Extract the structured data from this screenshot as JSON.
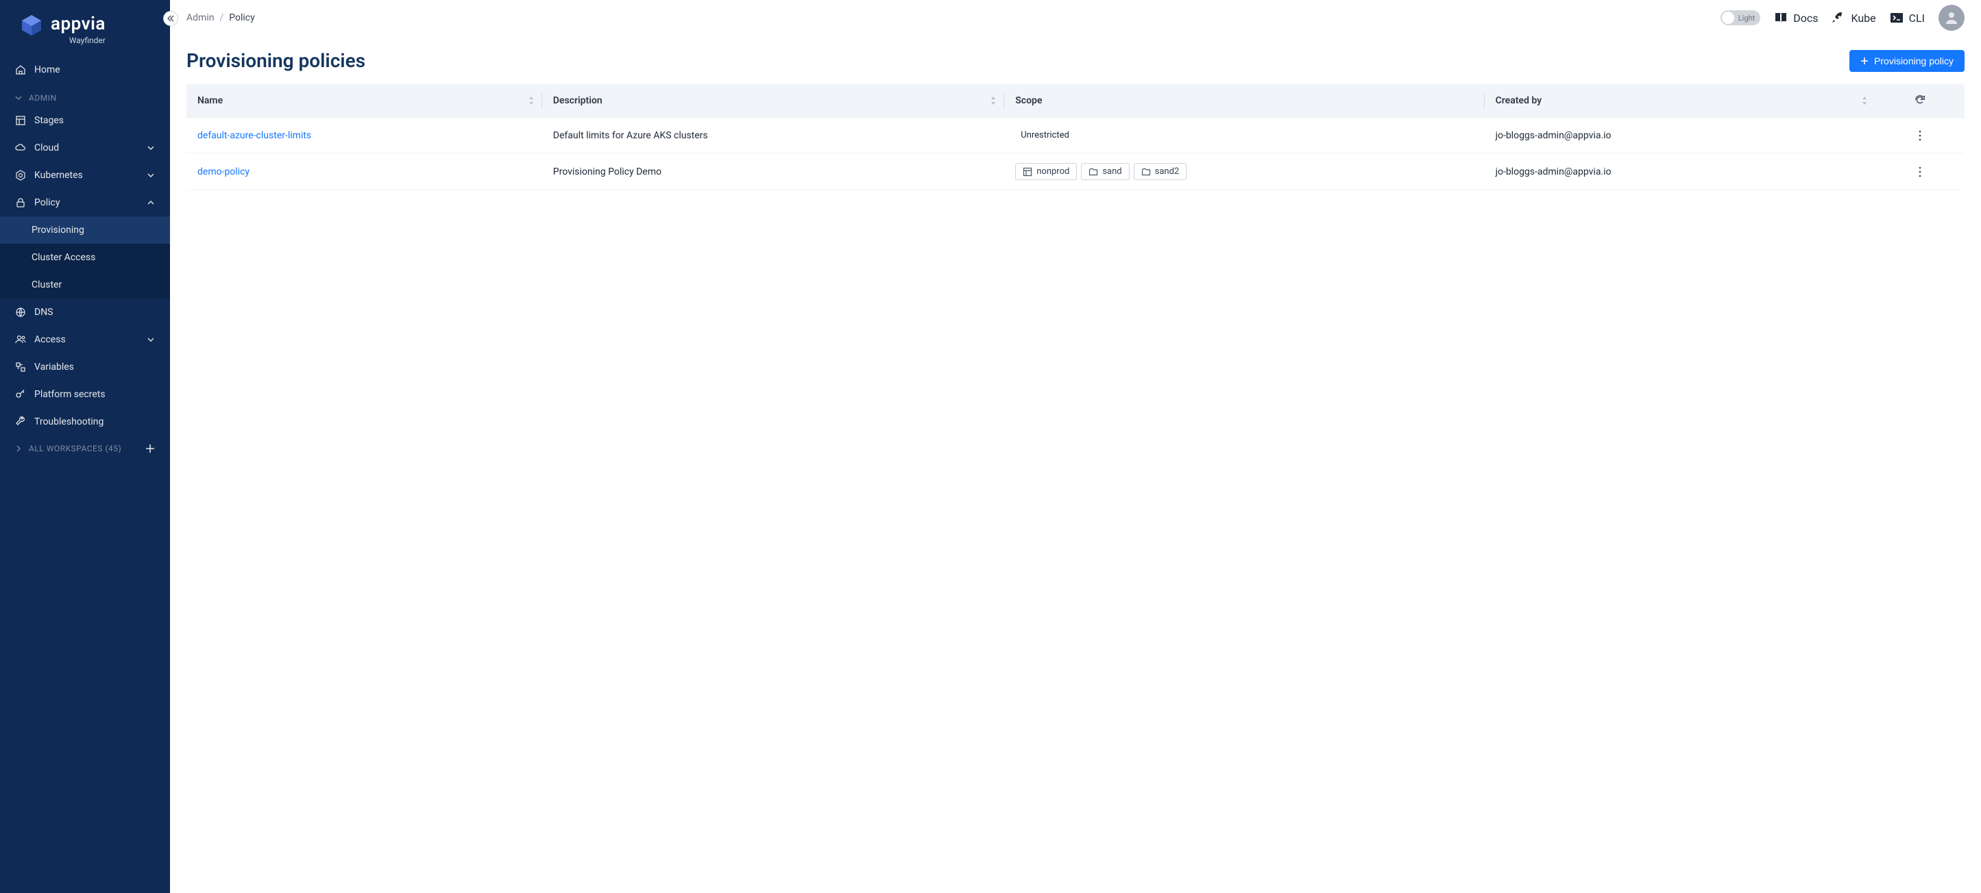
{
  "brand": {
    "name": "appvia",
    "subtitle": "Wayfinder"
  },
  "sidebar": {
    "home": "Home",
    "admin_label": "ADMIN",
    "items": {
      "stages": "Stages",
      "cloud": "Cloud",
      "kubernetes": "Kubernetes",
      "policy": "Policy",
      "dns": "DNS",
      "access": "Access",
      "variables": "Variables",
      "platform_secrets": "Platform secrets",
      "troubleshooting": "Troubleshooting"
    },
    "policy_sub": {
      "provisioning": "Provisioning",
      "cluster_access": "Cluster Access",
      "cluster": "Cluster"
    },
    "workspaces_label": "ALL WORKSPACES (45)"
  },
  "breadcrumbs": {
    "admin": "Admin",
    "policy": "Policy"
  },
  "topbar": {
    "theme_label": "Light",
    "docs": "Docs",
    "kube": "Kube",
    "cli": "CLI"
  },
  "page": {
    "title": "Provisioning policies",
    "new_button": "Provisioning policy"
  },
  "table": {
    "headers": {
      "name": "Name",
      "description": "Description",
      "scope": "Scope",
      "created_by": "Created by"
    },
    "rows": [
      {
        "name": "default-azure-cluster-limits",
        "description": "Default limits for Azure AKS clusters",
        "scope_type": "unrestricted",
        "scope_text": "Unrestricted",
        "created_by": "jo-bloggs-admin@appvia.io"
      },
      {
        "name": "demo-policy",
        "description": "Provisioning Policy Demo",
        "scope_type": "tags",
        "scope_tags": [
          {
            "type": "stage",
            "label": "nonprod"
          },
          {
            "type": "workspace",
            "label": "sand"
          },
          {
            "type": "workspace",
            "label": "sand2"
          }
        ],
        "created_by": "jo-bloggs-admin@appvia.io"
      }
    ]
  }
}
